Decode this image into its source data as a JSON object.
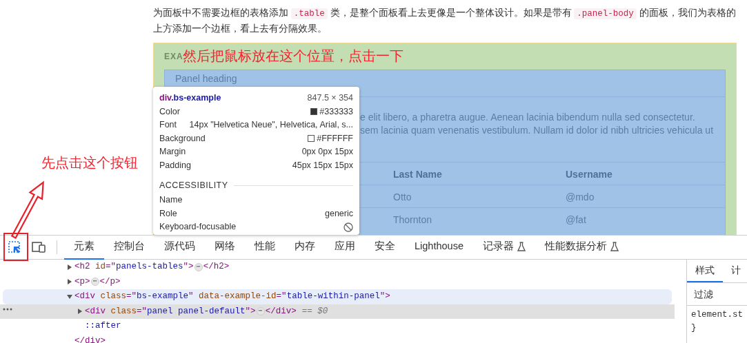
{
  "page": {
    "intro": [
      {
        "kind": "text",
        "text": "为面板中不需要边框的表格添加 "
      },
      {
        "kind": "code",
        "text": ".table"
      },
      {
        "kind": "text",
        "text": " 类，是整个面板看上去更像是一个整体设计。如果是带有 "
      },
      {
        "kind": "code",
        "text": ".panel-body"
      },
      {
        "kind": "text",
        "text": " 的面板，我们为表格的上方添加一个边框，看上去有分隔效果。"
      }
    ],
    "example": {
      "label": "EXA",
      "panel": {
        "heading": "Panel heading",
        "body_lines": [
          "e elit libero, a pharetra augue. Aenean lacinia bibendum nulla sed consectetur.",
          "sem lacinia quam venenatis vestibulum. Nullam id dolor id nibh ultricies vehicula ut"
        ],
        "columns": [
          "Last Name",
          "Username"
        ],
        "rows": [
          [
            "Otto",
            "@mdo"
          ],
          [
            "Thornton",
            "@fat"
          ]
        ]
      }
    }
  },
  "tooltip": {
    "tag": "div",
    "cls": ".bs-example",
    "size": "847.5 × 354",
    "props": [
      {
        "label": "Color",
        "value": "#333333",
        "color": "#333333"
      },
      {
        "label": "Font",
        "value": "14px \"Helvetica Neue\", Helvetica, Arial, s..."
      },
      {
        "label": "Background",
        "value": "#FFFFFF",
        "color": "#ffffff"
      },
      {
        "label": "Margin",
        "value": "0px 0px 15px"
      },
      {
        "label": "Padding",
        "value": "45px 15px 15px"
      }
    ],
    "section": "ACCESSIBILITY",
    "a11y": [
      {
        "label": "Name"
      },
      {
        "label": "Role",
        "value": "generic"
      },
      {
        "label": "Keyboard-focusable",
        "focusable": false
      }
    ]
  },
  "annotations": {
    "hover_hint": "然后把鼠标放在这个位置，点击一下",
    "click_hint": "先点击这个按钮"
  },
  "devtools": {
    "tools": [
      {
        "kind": "inspect",
        "selected": true
      },
      {
        "kind": "device",
        "selected": false
      }
    ],
    "tabs": [
      {
        "label": "元素",
        "selected": true
      },
      {
        "label": "控制台",
        "selected": false
      },
      {
        "label": "源代码",
        "selected": false
      },
      {
        "label": "网络",
        "selected": false
      },
      {
        "label": "性能",
        "selected": false
      },
      {
        "label": "内存",
        "selected": false
      },
      {
        "label": "应用",
        "selected": false
      },
      {
        "label": "安全",
        "selected": false
      },
      {
        "label": "Lighthouse",
        "selected": false
      },
      {
        "label": "记录器",
        "selected": false,
        "experimental": true
      },
      {
        "label": "性能数据分析",
        "selected": false,
        "experimental": true
      }
    ],
    "tree": [
      {
        "open": [
          {
            "kind": "tag",
            "text": "<h2"
          },
          {
            "kind": "attr",
            "text": " id"
          },
          {
            "kind": "tag",
            "text": "=\""
          },
          {
            "kind": "value",
            "text": "panels-tables"
          },
          {
            "kind": "tag",
            "text": "\">"
          }
        ],
        "ellipsis": "⋯",
        "close": "</h2>",
        "expanded": false,
        "hovered": false,
        "selected": false
      },
      {
        "open": [
          {
            "kind": "tag",
            "text": "<p>"
          }
        ],
        "ellipsis": "⋯",
        "close": "</p>",
        "expanded": false,
        "hovered": false,
        "selected": false
      },
      {
        "open": [
          {
            "kind": "tag",
            "text": "<div"
          },
          {
            "kind": "attr",
            "text": " class"
          },
          {
            "kind": "tag",
            "text": "=\""
          },
          {
            "kind": "value",
            "text": "bs-example"
          },
          {
            "kind": "tag",
            "text": "\""
          },
          {
            "kind": "attr",
            "text": " data-example-id"
          },
          {
            "kind": "tag",
            "text": "=\""
          },
          {
            "kind": "value",
            "text": "table-within-panel"
          },
          {
            "kind": "tag",
            "text": "\">"
          }
        ],
        "close": "</div>",
        "expanded": true,
        "hovered": true,
        "selected": false,
        "children": [
          {
            "open": [
              {
                "kind": "tag",
                "text": "<div"
              },
              {
                "kind": "attr",
                "text": " class"
              },
              {
                "kind": "tag",
                "text": "=\""
              },
              {
                "kind": "value",
                "text": "panel panel-default"
              },
              {
                "kind": "tag",
                "text": "\">"
              }
            ],
            "ellipsis": "⋯",
            "close": "</div>",
            "suffix": "== $0",
            "expanded": false,
            "hovered": false,
            "selected": true
          },
          {
            "pseudo": "::after",
            "hovered": false,
            "selected": false
          }
        ]
      }
    ],
    "styles": {
      "tabs": [
        {
          "label": "样式",
          "selected": true
        },
        {
          "label": "计",
          "selected": false
        }
      ],
      "filter_placeholder": "过滤",
      "lines": [
        "element.st",
        "}"
      ]
    }
  }
}
